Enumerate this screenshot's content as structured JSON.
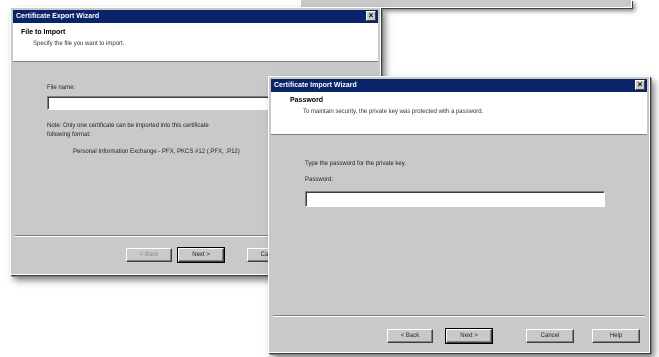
{
  "back_window": {
    "title": "Certificate Export Wizard",
    "close_glyph": "×",
    "header_title": "File to Import",
    "header_subtitle": "Specify the file you want to import.",
    "file_name_label": "File name:",
    "file_name_value": "",
    "note_line1": "Note: Only one certificate can be imported into this certificate",
    "note_line2": "following format:",
    "format_line": "Personal Information Exchange - PFX, PKCS #12 (.PFX, .P12)",
    "buttons": {
      "back": "< Back",
      "next": "Next >",
      "cancel": "Cancel"
    }
  },
  "front_window": {
    "title": "Certificate Import Wizard",
    "close_glyph": "×",
    "header_title": "Password",
    "header_subtitle": "To maintain security, the private key was protected with a password.",
    "instruction": "Type the password for the private key.",
    "password_label": "Password:",
    "password_value": "",
    "buttons": {
      "back": "< Back",
      "next": "Next >",
      "cancel": "Cancel",
      "help": "Help"
    }
  }
}
